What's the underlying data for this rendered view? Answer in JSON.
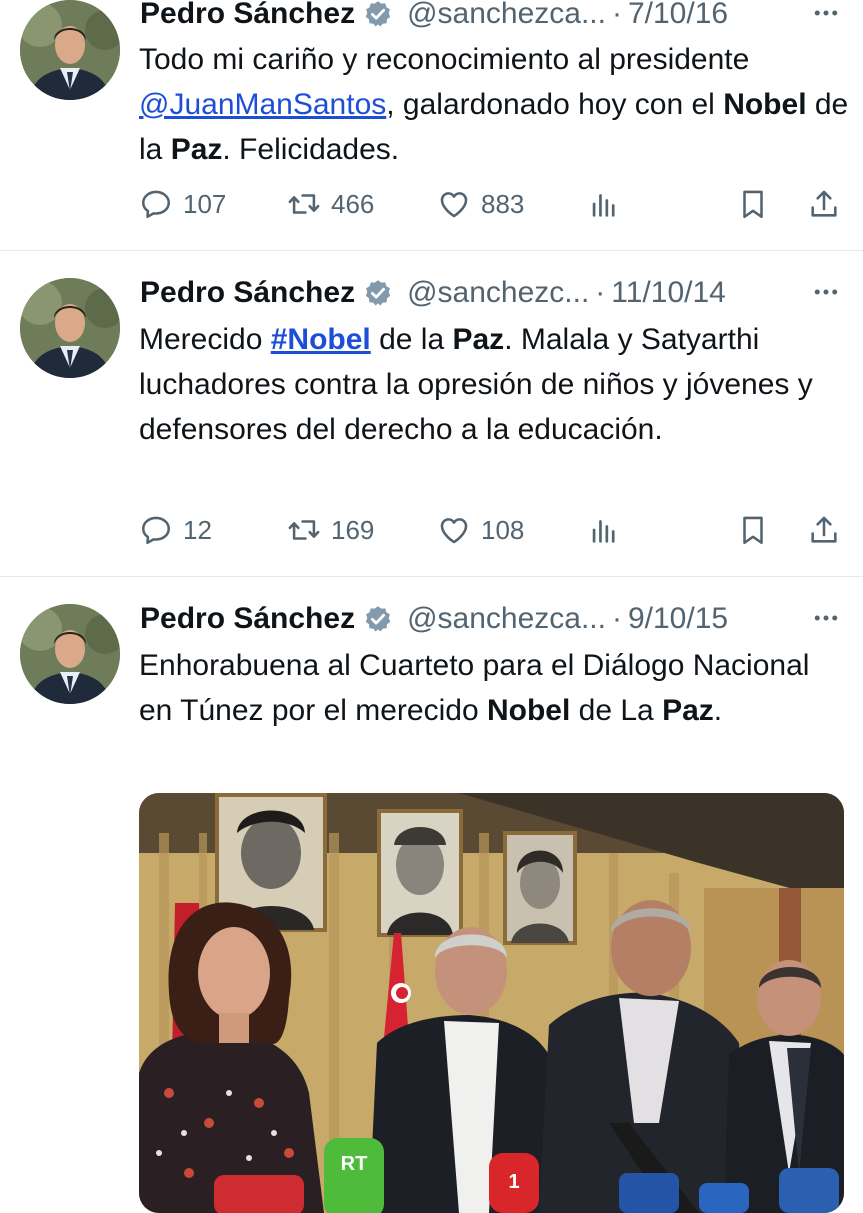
{
  "tweets": [
    {
      "name": "Pedro Sánchez",
      "handle": "@sanchezca...",
      "date": "7/10/16",
      "text_parts": [
        "Todo mi cariño y reconocimiento al presidente ",
        "@JuanManSantos",
        ", galardonado hoy con el ",
        "Nobel",
        " de la ",
        "Paz",
        ". Felicidades."
      ],
      "replies": "107",
      "retweets": "466",
      "likes": "883"
    },
    {
      "name": "Pedro Sánchez",
      "handle": "@sanchezc...",
      "date": "11/10/14",
      "text_parts": [
        "Merecido ",
        "#Nobel",
        " de la ",
        "Paz",
        ". Malala y Satyarthi luchadores contra la opresión de niños y jóvenes y defensores del derecho a la educación."
      ],
      "replies": "12",
      "retweets": "169",
      "likes": "108"
    },
    {
      "name": "Pedro Sánchez",
      "handle": "@sanchezca...",
      "date": "9/10/15",
      "text_parts": [
        "Enhorabuena al Cuarteto para el Diálogo Nacional en Túnez por el merecido ",
        "Nobel",
        " de La ",
        "Paz",
        "."
      ],
      "media": {
        "mic_labels": [
          "RT",
          "1"
        ]
      }
    }
  ],
  "separator": "·",
  "colors": {
    "link": "#1d4ed8",
    "muted": "#536471",
    "verified": "#829aab"
  },
  "icons": [
    "reply-icon",
    "retweet-icon",
    "like-icon",
    "views-icon",
    "bookmark-icon",
    "share-icon",
    "more-icon",
    "verified-badge-icon"
  ]
}
